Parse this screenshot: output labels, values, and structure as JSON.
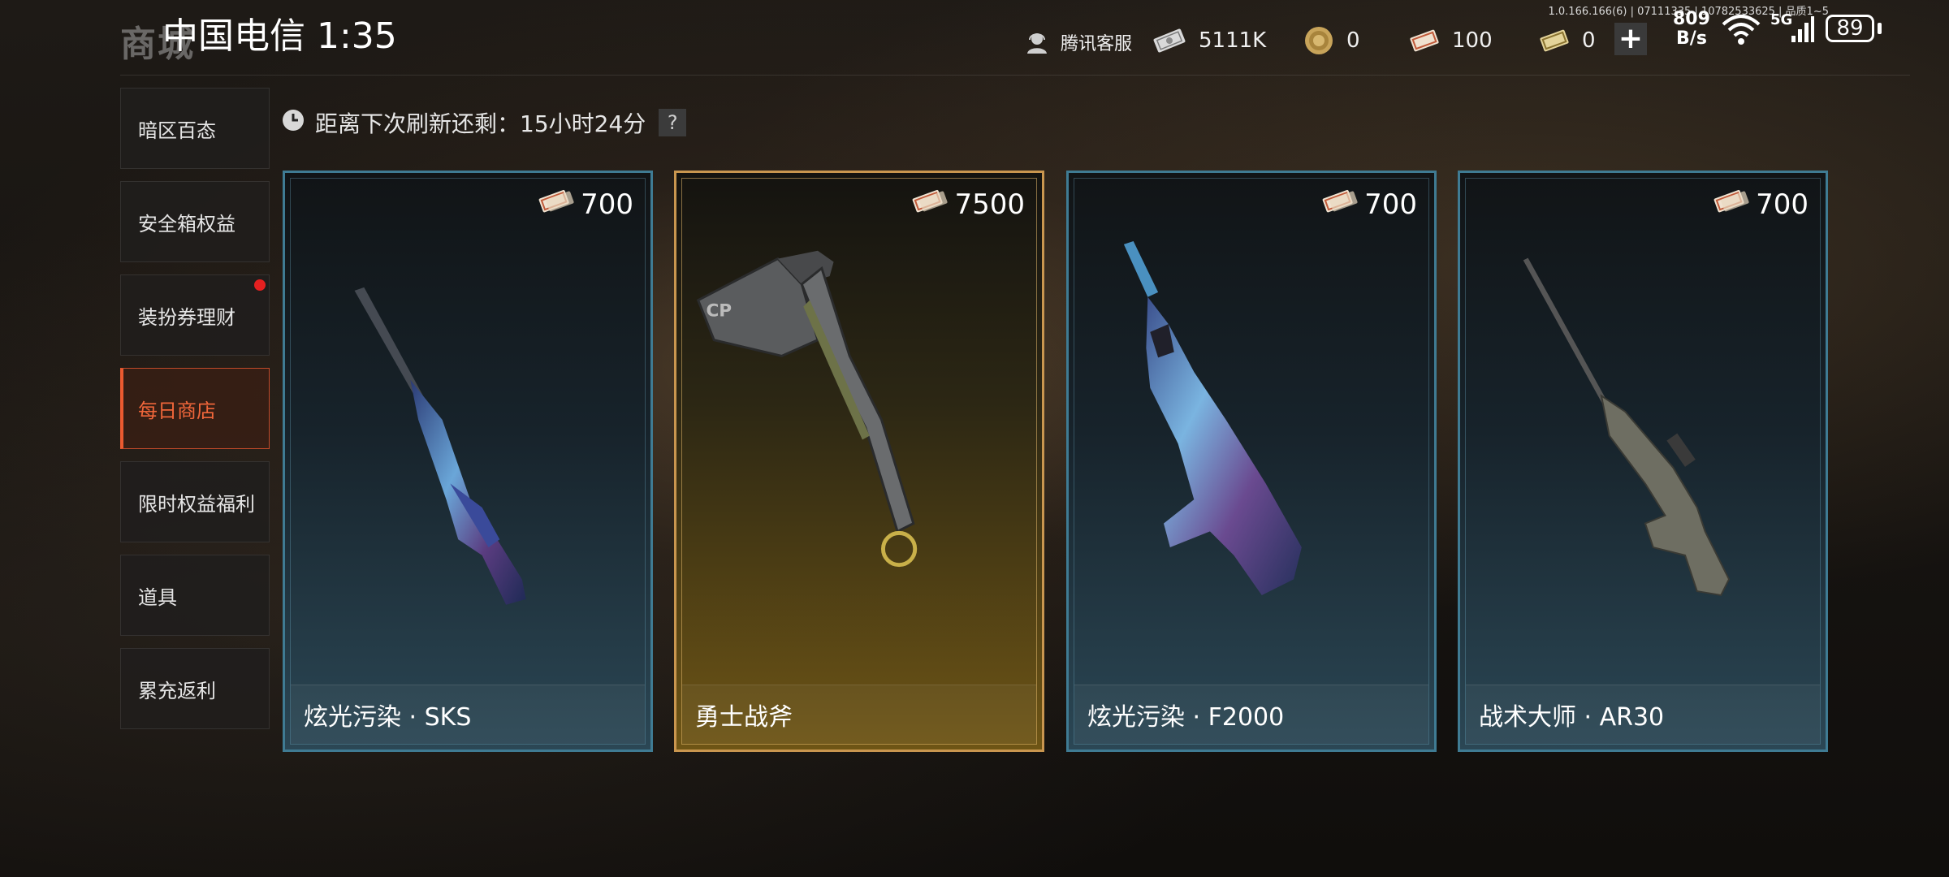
{
  "status_bar": {
    "carrier_time": "中国电信 1:35",
    "build_info": "1.0.166.166(6) | 07111335 | 10782533625 | 品质1~5",
    "net_speed_value": "809",
    "net_speed_unit": "B/s",
    "network": "5G",
    "battery": "89"
  },
  "header": {
    "title": "商城",
    "customer_service": "腾讯客服",
    "currencies": [
      {
        "icon": "cash-bill-icon",
        "value": "5111K"
      },
      {
        "icon": "gold-coin-icon",
        "value": "0"
      },
      {
        "icon": "dress-voucher-icon",
        "value": "100"
      },
      {
        "icon": "gold-voucher-icon",
        "value": "0"
      }
    ],
    "add_label": "+"
  },
  "sidebar": {
    "items": [
      {
        "label": "暗区百态",
        "active": false,
        "dot": false
      },
      {
        "label": "安全箱权益",
        "active": false,
        "dot": false
      },
      {
        "label": "装扮券理财",
        "active": false,
        "dot": true
      },
      {
        "label": "每日商店",
        "active": true,
        "dot": false
      },
      {
        "label": "限时权益福利",
        "active": false,
        "dot": false
      },
      {
        "label": "道具",
        "active": false,
        "dot": false
      },
      {
        "label": "累充返利",
        "active": false,
        "dot": false
      }
    ]
  },
  "refresh": {
    "text": "距离下次刷新还剩：15小时24分",
    "help": "?"
  },
  "shop": {
    "items": [
      {
        "name": "炫光污染 · SKS",
        "price": "700",
        "rarity": "blue",
        "icon": "sks-rifle-icon"
      },
      {
        "name": "勇士战斧",
        "price": "7500",
        "rarity": "gold",
        "icon": "tomahawk-axe-icon"
      },
      {
        "name": "炫光污染 · F2000",
        "price": "700",
        "rarity": "blue",
        "icon": "f2000-rifle-icon"
      },
      {
        "name": "战术大师 · AR30",
        "price": "700",
        "rarity": "blue",
        "icon": "ar30-sniper-icon"
      }
    ]
  },
  "colors": {
    "accent_active": "#f0663a",
    "card_blue_border": "#3f7b93",
    "card_gold_border": "#c9964f",
    "badge_red": "#e42020"
  }
}
